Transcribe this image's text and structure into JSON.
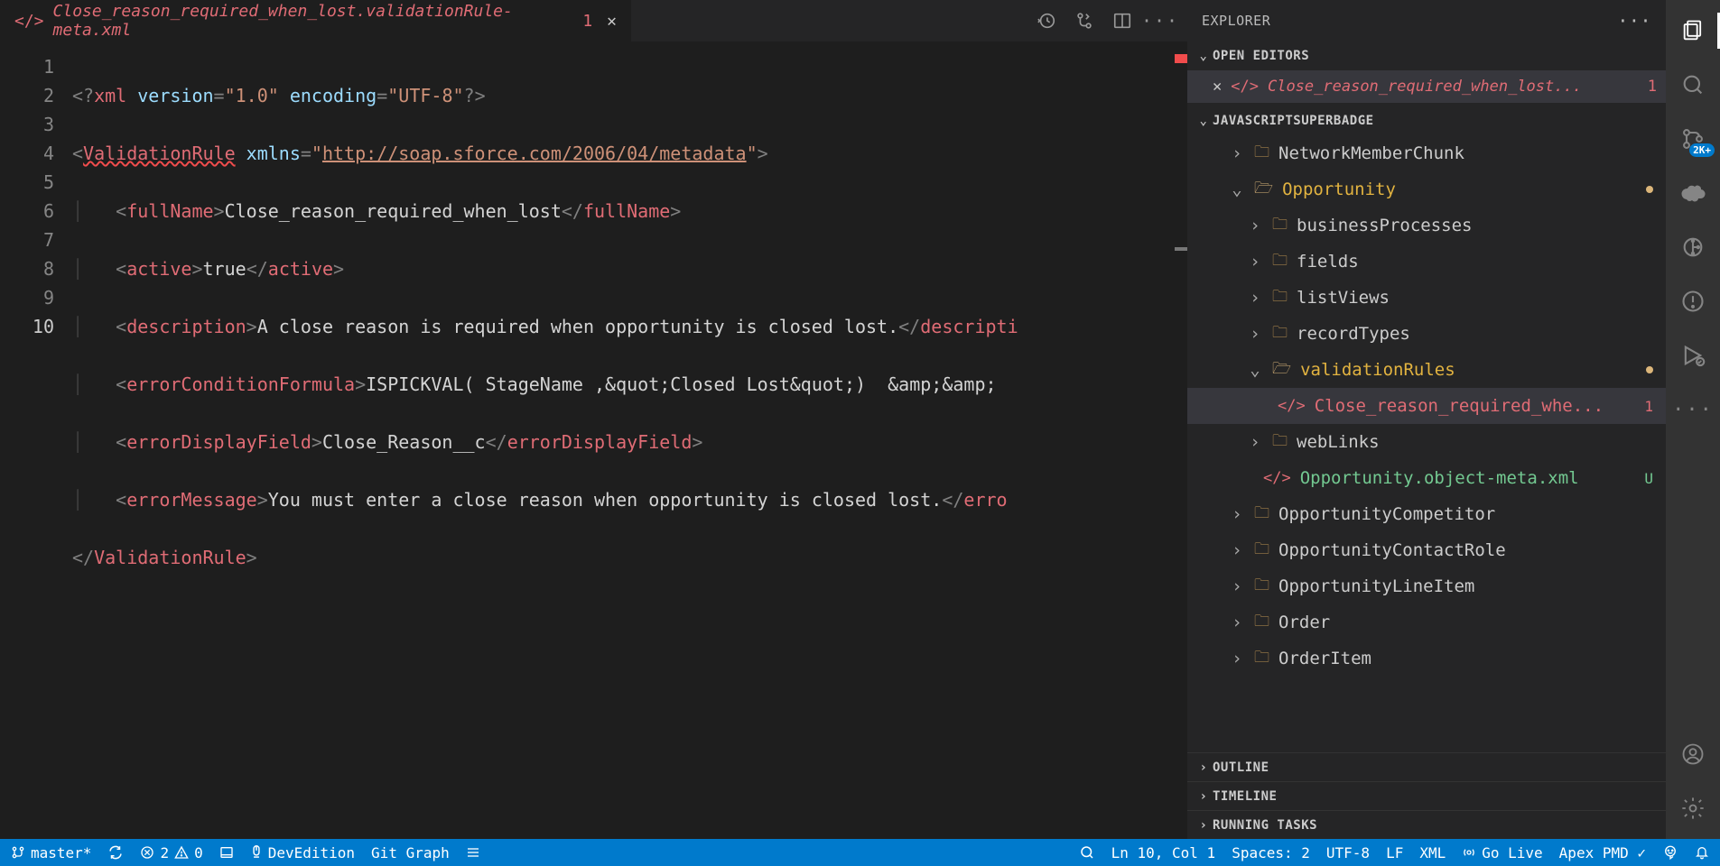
{
  "tab": {
    "filename": "Close_reason_required_when_lost.validationRule-meta.xml",
    "problems": "1"
  },
  "code": {
    "l1": {
      "pi_open": "<?",
      "pi_name": "xml",
      "attr1": " version",
      "val1": "\"1.0\"",
      "attr2": " encoding",
      "val2": "\"UTF-8\"",
      "pi_close": "?>"
    },
    "l2": {
      "open": "<",
      "tag": "ValidationRule",
      "attr": " xmlns",
      "eq": "=",
      "q": "\"",
      "url": "http://soap.sforce.com/2006/04/metadata",
      "close_q": "\"",
      "close": ">"
    },
    "l3": {
      "open": "<",
      "tag": "fullName",
      "close": ">",
      "text": "Close_reason_required_when_lost",
      "copen": "</",
      "ctag": "fullName",
      "cclose": ">"
    },
    "l4": {
      "open": "<",
      "tag": "active",
      "close": ">",
      "text": "true",
      "copen": "</",
      "ctag": "active",
      "cclose": ">"
    },
    "l5": {
      "open": "<",
      "tag": "description",
      "close": ">",
      "text": "A close reason is required when opportunity is closed lost.",
      "copen": "</",
      "ctag": "descripti"
    },
    "l6": {
      "open": "<",
      "tag": "errorConditionFormula",
      "close": ">",
      "text": "ISPICKVAL( StageName ,&quot;Closed Lost&quot;)  &amp;&amp;"
    },
    "l7": {
      "open": "<",
      "tag": "errorDisplayField",
      "close": ">",
      "text": "Close_Reason__c",
      "copen": "</",
      "ctag": "errorDisplayField",
      "cclose": ">"
    },
    "l8": {
      "open": "<",
      "tag": "errorMessage",
      "close": ">",
      "text": "You must enter a close reason when opportunity is closed lost.",
      "copen": "</",
      "ctag": "erro"
    },
    "l9": {
      "open": "</",
      "tag": "ValidationRule",
      "close": ">"
    }
  },
  "explorer": {
    "title": "EXPLORER",
    "open_editors": "OPEN EDITORS",
    "open_file": "Close_reason_required_when_lost...",
    "open_badge": "1",
    "repo": "JAVASCRIPTSUPERBADGE",
    "tree": {
      "nmc": "NetworkMemberChunk",
      "opp": "Opportunity",
      "bp": "businessProcesses",
      "fields": "fields",
      "lv": "listViews",
      "rt": "recordTypes",
      "vr": "validationRules",
      "vrfile": "Close_reason_required_whe...",
      "vrbadge": "1",
      "wl": "webLinks",
      "oppmeta": "Opportunity.object-meta.xml",
      "ubadge": "U",
      "oc": "OpportunityCompetitor",
      "ocr": "OpportunityContactRole",
      "oli": "OpportunityLineItem",
      "order": "Order",
      "oi": "OrderItem"
    },
    "outline": "OUTLINE",
    "timeline": "TIMELINE",
    "running": "RUNNING TASKS"
  },
  "activity": {
    "scm_badge": "2K+"
  },
  "status": {
    "branch": "master*",
    "errors": "2",
    "warnings": "0",
    "org": "DevEdition",
    "gitgraph": "Git Graph",
    "cursor": "Ln 10, Col 1",
    "spaces": "Spaces: 2",
    "encoding": "UTF-8",
    "eol": "LF",
    "lang": "XML",
    "golive": "Go Live",
    "apex": "Apex PMD ✓"
  }
}
